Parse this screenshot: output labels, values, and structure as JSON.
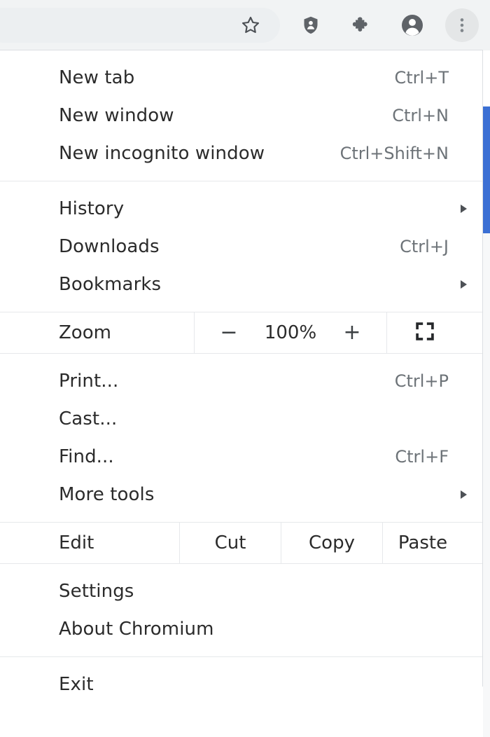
{
  "toolbar": {
    "icons": [
      {
        "name": "bookmark-star-icon",
        "label": "Bookmark this tab"
      },
      {
        "name": "tracking-shield-icon",
        "label": "Tracking protection"
      },
      {
        "name": "extensions-puzzle-icon",
        "label": "Extensions"
      },
      {
        "name": "profile-avatar-icon",
        "label": "Profile"
      },
      {
        "name": "three-dot-menu-icon",
        "label": "Customize and control Chromium"
      }
    ],
    "menu_button_active": true
  },
  "menu": {
    "groups": [
      {
        "id": "new",
        "items": [
          {
            "label": "New tab",
            "accel": "Ctrl+T",
            "submenu": false
          },
          {
            "label": "New window",
            "accel": "Ctrl+N",
            "submenu": false
          },
          {
            "label": "New incognito window",
            "accel": "Ctrl+Shift+N",
            "submenu": false
          }
        ]
      },
      {
        "id": "browse",
        "items": [
          {
            "label": "History",
            "accel": "",
            "submenu": true
          },
          {
            "label": "Downloads",
            "accel": "Ctrl+J",
            "submenu": false
          },
          {
            "label": "Bookmarks",
            "accel": "",
            "submenu": true
          }
        ]
      },
      {
        "id": "tools",
        "items": [
          {
            "label": "Print...",
            "accel": "Ctrl+P",
            "submenu": false
          },
          {
            "label": "Cast...",
            "accel": "",
            "submenu": false
          },
          {
            "label": "Find...",
            "accel": "Ctrl+F",
            "submenu": false
          },
          {
            "label": "More tools",
            "accel": "",
            "submenu": true
          }
        ]
      },
      {
        "id": "app",
        "items": [
          {
            "label": "Settings",
            "accel": "",
            "submenu": false
          },
          {
            "label": "About Chromium",
            "accel": "",
            "submenu": false
          }
        ]
      },
      {
        "id": "quit",
        "items": [
          {
            "label": "Exit",
            "accel": "",
            "submenu": false
          }
        ]
      }
    ],
    "zoom": {
      "label": "Zoom",
      "decrease": "−",
      "level": "100%",
      "increase": "+",
      "fullscreen_icon": "fullscreen-icon"
    },
    "edit": {
      "label": "Edit",
      "cut": "Cut",
      "copy": "Copy",
      "paste": "Paste"
    }
  },
  "colors": {
    "toolbar_bg": "#f1f3f4",
    "menu_bg": "#ffffff",
    "menu_text": "#2b2b2b",
    "accel_text": "#6d7378",
    "separator": "#e6e8eb",
    "page_accent": "#3b6fd4"
  }
}
